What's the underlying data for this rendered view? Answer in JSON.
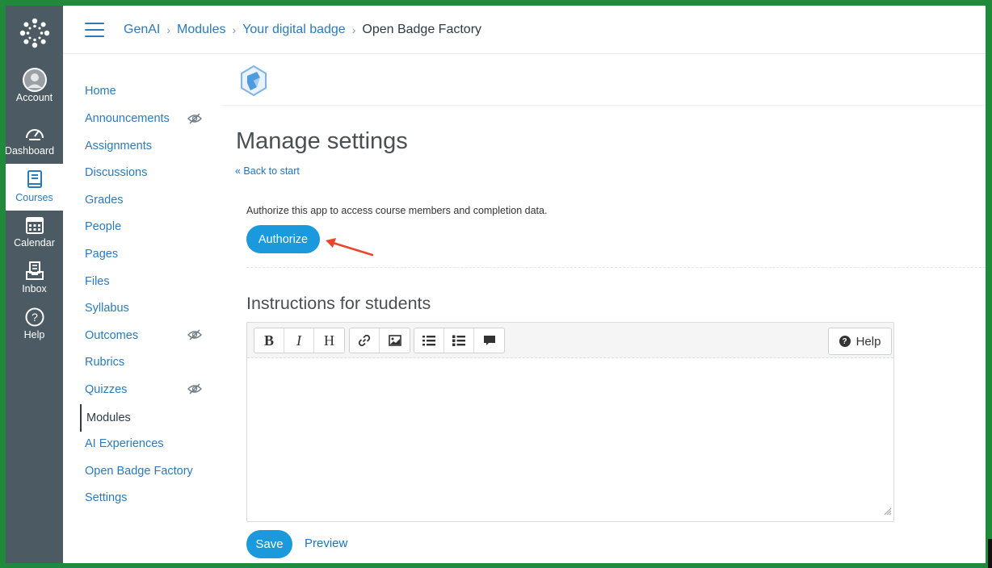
{
  "global_nav": {
    "items": [
      {
        "label": "Account",
        "icon": "avatar-icon"
      },
      {
        "label": "Dashboard",
        "icon": "dashboard-icon"
      },
      {
        "label": "Courses",
        "icon": "book-icon"
      },
      {
        "label": "Calendar",
        "icon": "calendar-icon"
      },
      {
        "label": "Inbox",
        "icon": "inbox-icon"
      },
      {
        "label": "Help",
        "icon": "help-icon"
      }
    ],
    "active": "Courses"
  },
  "breadcrumb": {
    "items": [
      "GenAI",
      "Modules",
      "Your digital badge",
      "Open Badge Factory"
    ],
    "separator": ">"
  },
  "course_nav": {
    "items": [
      {
        "label": "Home",
        "hidden_icon": false
      },
      {
        "label": "Announcements",
        "hidden_icon": true
      },
      {
        "label": "Assignments",
        "hidden_icon": false
      },
      {
        "label": "Discussions",
        "hidden_icon": false
      },
      {
        "label": "Grades",
        "hidden_icon": false
      },
      {
        "label": "People",
        "hidden_icon": false
      },
      {
        "label": "Pages",
        "hidden_icon": false
      },
      {
        "label": "Files",
        "hidden_icon": false
      },
      {
        "label": "Syllabus",
        "hidden_icon": false
      },
      {
        "label": "Outcomes",
        "hidden_icon": true
      },
      {
        "label": "Rubrics",
        "hidden_icon": false
      },
      {
        "label": "Quizzes",
        "hidden_icon": true
      },
      {
        "label": "Modules",
        "hidden_icon": false
      },
      {
        "label": "AI Experiences",
        "hidden_icon": false
      },
      {
        "label": "Open Badge Factory",
        "hidden_icon": false
      },
      {
        "label": "Settings",
        "hidden_icon": false
      }
    ],
    "active": "Modules"
  },
  "main": {
    "title": "Manage settings",
    "back_link": "« Back to start",
    "authorize_text": "Authorize this app to access course members and completion data.",
    "authorize_button": "Authorize",
    "instructions_title": "Instructions for students",
    "editor": {
      "toolbar": [
        {
          "group": "format",
          "buttons": [
            {
              "name": "bold",
              "glyph": "B"
            },
            {
              "name": "italic",
              "glyph": "I"
            },
            {
              "name": "heading",
              "glyph": "H"
            }
          ]
        },
        {
          "group": "insert",
          "buttons": [
            {
              "name": "link",
              "glyph": "link-icon"
            },
            {
              "name": "image",
              "glyph": "image-icon"
            }
          ]
        },
        {
          "group": "lists",
          "buttons": [
            {
              "name": "numbered-list",
              "glyph": "numbered-list-icon"
            },
            {
              "name": "bulleted-list",
              "glyph": "bulleted-list-icon"
            },
            {
              "name": "quote",
              "glyph": "quote-icon"
            }
          ]
        }
      ],
      "help_label": "Help",
      "content": ""
    },
    "save_button": "Save",
    "preview_link": "Preview"
  },
  "colors": {
    "frame": "#1f8a3b",
    "global_nav_bg": "#4b5a63",
    "link": "#2b7abc",
    "button": "#1a99dd",
    "annotation_arrow": "#e8462a"
  }
}
